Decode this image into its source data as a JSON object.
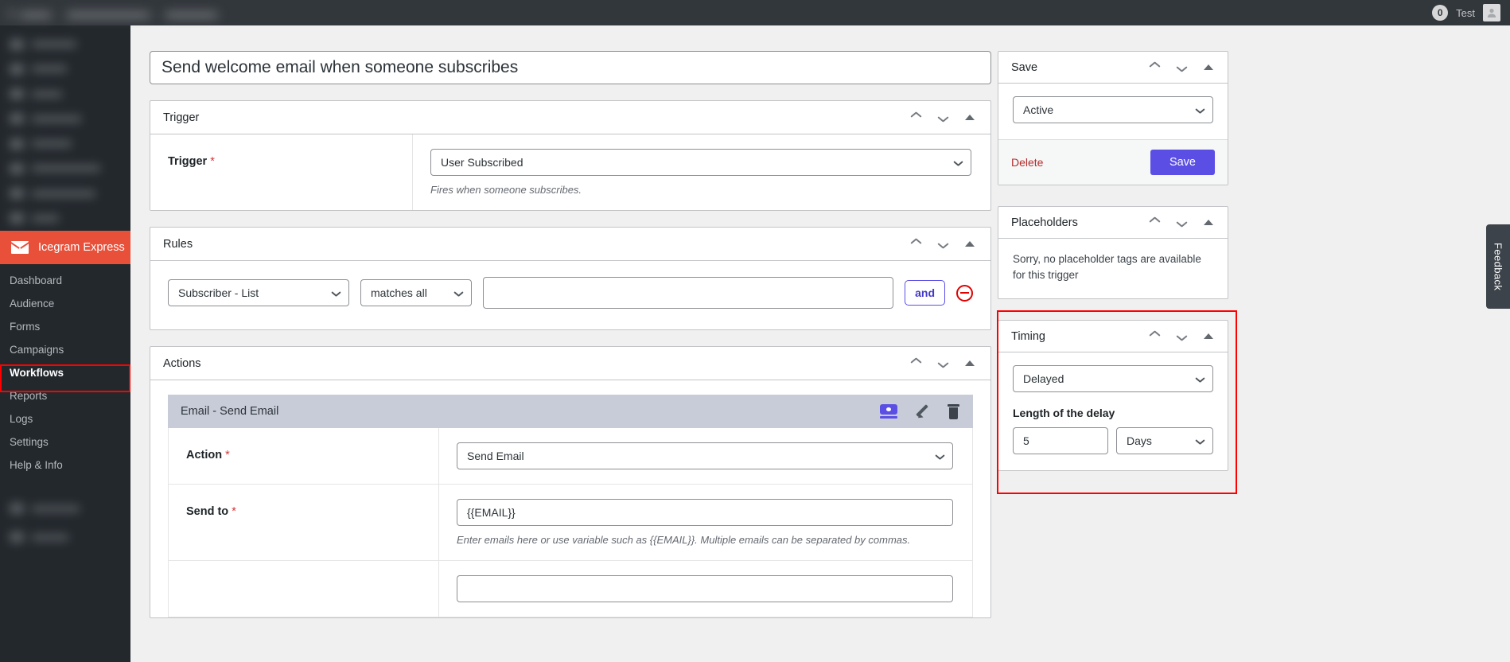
{
  "adminbar": {
    "blurred_items": [
      "",
      "",
      ""
    ],
    "comment_count": "0",
    "user_name": "Test",
    "avatar_icon": "user-avatar-icon"
  },
  "sidebar": {
    "brand": {
      "label": "Icegram Express",
      "icon": "envelope-icon",
      "color": "#e8503a"
    },
    "items": [
      {
        "label": "Dashboard",
        "active": false
      },
      {
        "label": "Audience",
        "active": false
      },
      {
        "label": "Forms",
        "active": false
      },
      {
        "label": "Campaigns",
        "active": false
      },
      {
        "label": "Workflows",
        "active": true
      },
      {
        "label": "Reports",
        "active": false
      },
      {
        "label": "Logs",
        "active": false
      },
      {
        "label": "Settings",
        "active": false
      },
      {
        "label": "Help & Info",
        "active": false
      }
    ]
  },
  "workflow": {
    "title_value": "Send welcome email when someone subscribes",
    "title_placeholder": "Enter workflow name"
  },
  "panels": {
    "trigger": {
      "header": "Trigger",
      "field_label": "Trigger",
      "required_mark": "*",
      "value": "User Subscribed",
      "hint": "Fires when someone subscribes."
    },
    "rules": {
      "header": "Rules",
      "field_select": "Subscriber - List",
      "operator_select": "matches all",
      "value_input": "",
      "value_placeholder": "",
      "and_label": "and",
      "remove_icon": "remove-circle-icon"
    },
    "actions": {
      "header": "Actions",
      "block_title": "Email - Send Email",
      "icons": {
        "preview": "eye-preview-icon",
        "edit": "pencil-edit-icon",
        "delete": "trash-delete-icon"
      },
      "rows": [
        {
          "label": "Action",
          "required_mark": "*",
          "type": "select",
          "value": "Send Email",
          "hint": ""
        },
        {
          "label": "Send to",
          "required_mark": "*",
          "type": "text",
          "value": "{{EMAIL}}",
          "hint": "Enter emails here or use variable such as {{EMAIL}}. Multiple emails can be separated by commas."
        }
      ]
    }
  },
  "side": {
    "save": {
      "header": "Save",
      "status_value": "Active",
      "delete_label": "Delete",
      "save_label": "Save"
    },
    "placeholders": {
      "header": "Placeholders",
      "note": "Sorry, no placeholder tags are available for this trigger"
    },
    "timing": {
      "header": "Timing",
      "mode_value": "Delayed",
      "delay_label": "Length of the delay",
      "delay_amount": "5",
      "delay_unit": "Days"
    }
  },
  "icons": {
    "chevron_up": "chevron-up-icon",
    "chevron_down": "chevron-down-icon",
    "collapse_triangle": "collapse-triangle-icon"
  },
  "feedback": {
    "label": "Feedback"
  },
  "annotations": {
    "workflows_highlight_color": "#ff0000",
    "timing_highlight_color": "#ff0000"
  }
}
